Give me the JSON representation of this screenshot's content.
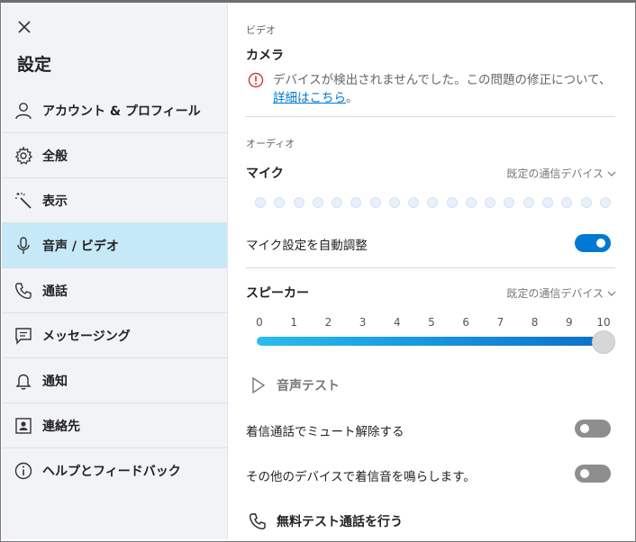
{
  "sidebar": {
    "close_label": "×",
    "title": "設定",
    "items": [
      {
        "label": "アカウント & プロフィール",
        "icon": "person-icon"
      },
      {
        "label": "全般",
        "icon": "gear-icon"
      },
      {
        "label": "表示",
        "icon": "magic-wand-icon"
      },
      {
        "label": "音声 / ビデオ",
        "icon": "microphone-icon",
        "active": true
      },
      {
        "label": "通話",
        "icon": "phone-icon"
      },
      {
        "label": "メッセージング",
        "icon": "message-icon"
      },
      {
        "label": "通知",
        "icon": "bell-icon"
      },
      {
        "label": "連絡先",
        "icon": "contact-card-icon"
      },
      {
        "label": "ヘルプとフィードバック",
        "icon": "info-icon"
      }
    ]
  },
  "video": {
    "section_label": "ビデオ",
    "camera_title": "カメラ",
    "warning_text": "デバイスが検出されませんでした。この問題の修正について、",
    "warning_link": "詳細はこちら",
    "warning_end": "。"
  },
  "audio": {
    "section_label": "オーディオ",
    "mic_title": "マイク",
    "mic_device": "既定の通信デバイス",
    "mic_level_dots": 19,
    "auto_adjust_label": "マイク設定を自動調整",
    "auto_adjust_on": true,
    "speaker_title": "スピーカー",
    "speaker_device": "既定の通信デバイス",
    "volume_scale": [
      "0",
      "1",
      "2",
      "3",
      "4",
      "5",
      "6",
      "7",
      "8",
      "9",
      "10"
    ],
    "volume_value": 10,
    "audio_test_label": "音声テスト",
    "unmute_label": "着信通話でミュート解除する",
    "unmute_on": false,
    "ring_other_label": "その他のデバイスで着信音を鳴らします。",
    "ring_other_on": false,
    "free_test_call_label": "無料テスト通話を行う"
  },
  "colors": {
    "accent": "#0078d4",
    "active_nav": "#c6e9f7",
    "warning": "#d13438"
  }
}
